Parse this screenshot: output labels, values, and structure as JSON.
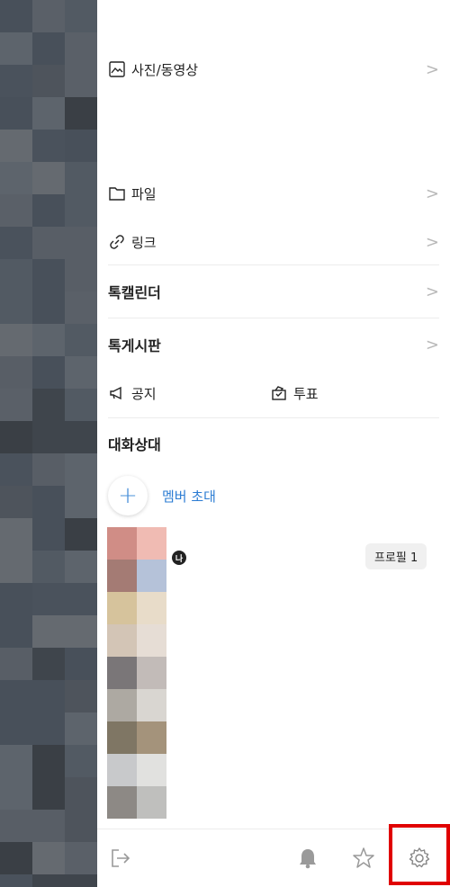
{
  "menu": {
    "photos_label": "사진/동영상",
    "files_label": "파일",
    "links_label": "링크",
    "calendar_label": "톡캘린더",
    "board_label": "톡게시판",
    "notice_label": "공지",
    "vote_label": "투표"
  },
  "members": {
    "section_title": "대화상대",
    "invite_label": "멤버 초대",
    "me_badge": "나",
    "profile_badge": "프로필 1"
  },
  "colors": {
    "accent": "#2b7cd3",
    "highlight": "#e00000"
  },
  "icons": {
    "photos": "image-icon",
    "files": "folder-icon",
    "links": "link-icon",
    "notice": "megaphone-icon",
    "vote": "ballot-box-icon",
    "exit": "exit-icon",
    "bell": "bell-icon",
    "star": "star-icon",
    "settings": "gear-icon"
  }
}
